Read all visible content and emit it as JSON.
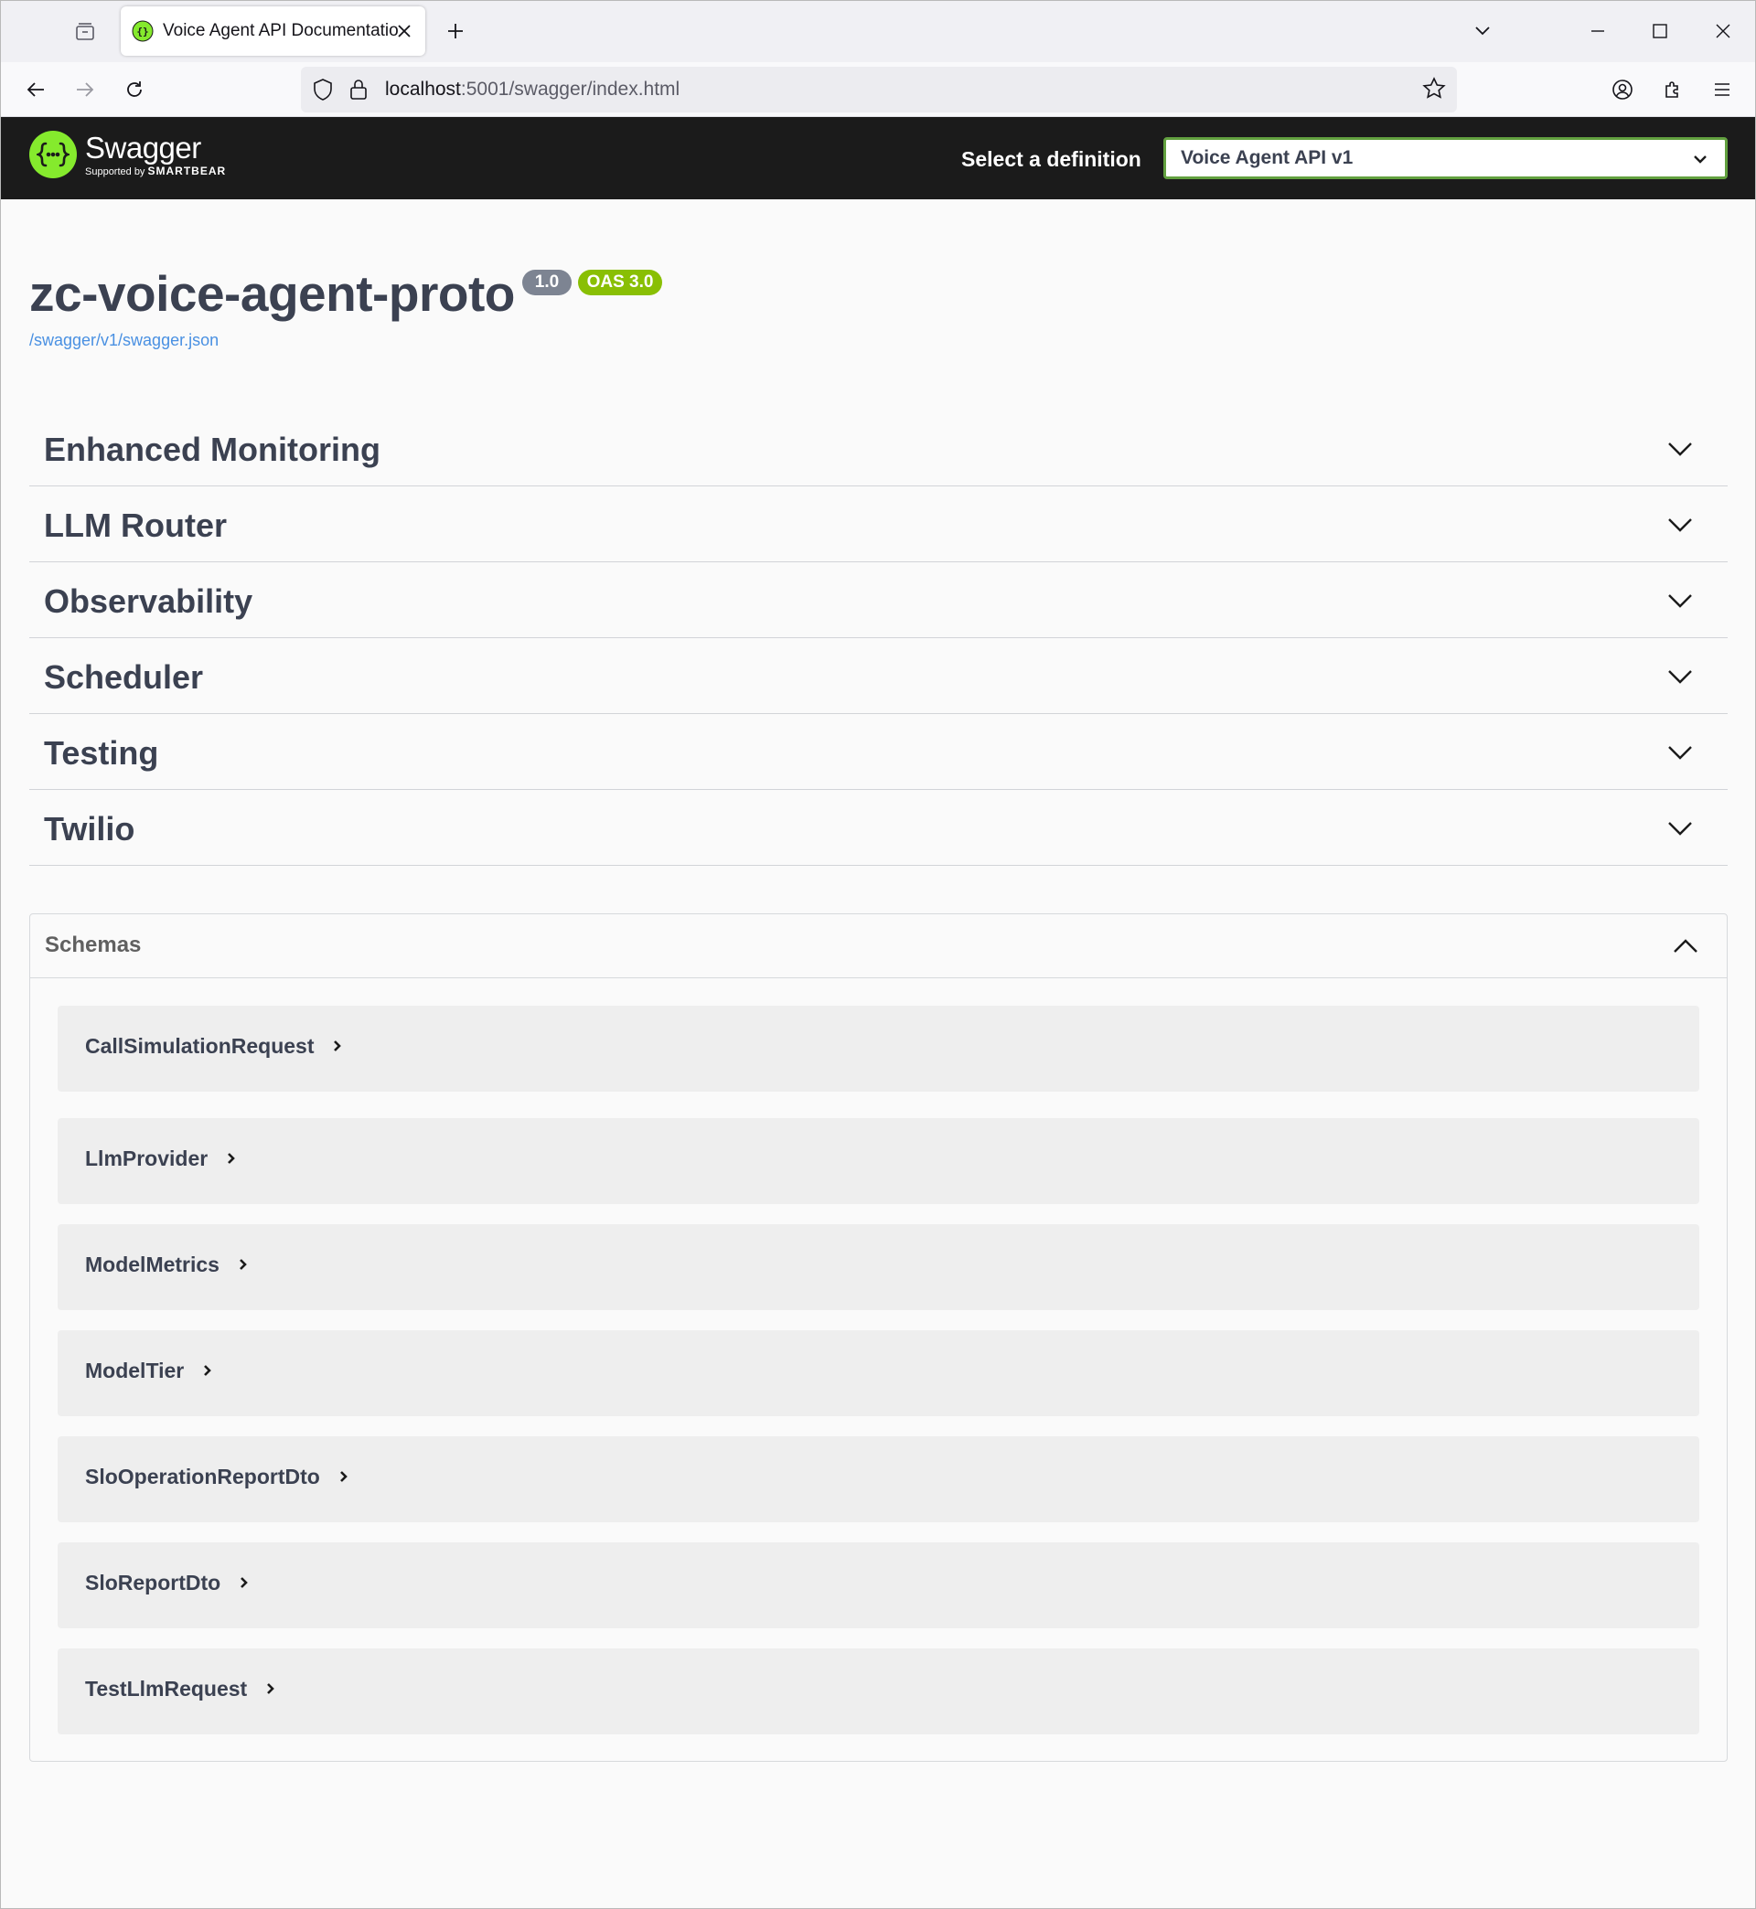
{
  "browser": {
    "tab_title": "Voice Agent API Documentation",
    "url_host": "localhost",
    "url_path": ":5001/swagger/index.html"
  },
  "topbar": {
    "logo_word": "Swagger",
    "logo_sub_prefix": "Supported by ",
    "logo_sub_brand": "SMARTBEAR",
    "definition_label": "Select a definition",
    "definition_value": "Voice Agent API v1"
  },
  "info": {
    "title": "zc-voice-agent-proto",
    "version": "1.0",
    "oas": "OAS 3.0",
    "spec_link": "/swagger/v1/swagger.json"
  },
  "tags": [
    {
      "name": "Enhanced Monitoring"
    },
    {
      "name": "LLM Router"
    },
    {
      "name": "Observability"
    },
    {
      "name": "Scheduler"
    },
    {
      "name": "Testing"
    },
    {
      "name": "Twilio"
    }
  ],
  "schemas": {
    "title": "Schemas",
    "models": [
      {
        "name": "CallSimulationRequest"
      },
      {
        "name": "LlmProvider"
      },
      {
        "name": "ModelMetrics"
      },
      {
        "name": "ModelTier"
      },
      {
        "name": "SloOperationReportDto"
      },
      {
        "name": "SloReportDto"
      },
      {
        "name": "TestLlmRequest"
      }
    ]
  },
  "colors": {
    "accent_green": "#85ea2d",
    "select_border": "#62a03f",
    "oas_badge": "#89bf04",
    "version_badge": "#7d8492",
    "link": "#4990e2",
    "topbar_bg": "#1b1b1b"
  }
}
